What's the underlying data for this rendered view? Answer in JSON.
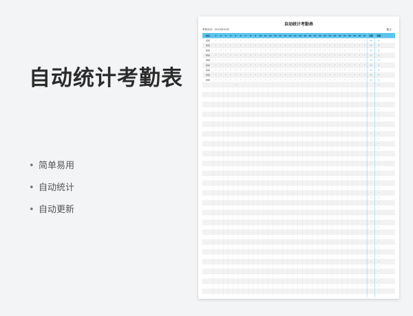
{
  "page": {
    "title": "自动统计考勤表"
  },
  "features": [
    "简单易用",
    "自动统计",
    "自动更新"
  ],
  "sheet": {
    "title": "自动统计考勤表",
    "month_label": "考勤月份：XXXX年XX月",
    "note": "备注：",
    "headers": {
      "name": "姓名",
      "days": [
        "1",
        "2",
        "3",
        "4",
        "5",
        "6",
        "7",
        "8",
        "9",
        "10",
        "11",
        "12",
        "13",
        "14",
        "15",
        "16",
        "17",
        "18",
        "19",
        "20",
        "21",
        "22",
        "23",
        "24",
        "25",
        "26",
        "27",
        "28",
        "29",
        "30",
        "31"
      ],
      "attend": "出勤",
      "absent": "缺勤"
    },
    "rows": [
      {
        "name": "某某",
        "marks": "√√√√√√√√√√√√√√√√√√√√√√√√√√√√√√√",
        "attend": "22",
        "absent": "8"
      },
      {
        "name": "某某",
        "marks": "√√√√√√√√√√√√√√√√√√√√√√√√√√√√√√√",
        "attend": "22",
        "absent": "8"
      },
      {
        "name": "某某",
        "marks": "√√√√√√√√√√√√√√√√√√√√√√√√√√√√√√√",
        "attend": "22",
        "absent": "8"
      },
      {
        "name": "某某",
        "marks": "√√√√√√√√√√√√√√√√√√√√√√√√√√√√√√√",
        "attend": "22",
        "absent": "8"
      },
      {
        "name": "某某",
        "marks": "√√√√√√√√√√√√√√√√√√√√√√√√√√√√√√√",
        "attend": "22",
        "absent": "8"
      },
      {
        "name": "某某",
        "marks": "√√√√√√√√√√√√√√√√√√√√√√√√√√√√√√√",
        "attend": "22",
        "absent": "8"
      },
      {
        "name": "某某",
        "marks": "√√√√√√√√√√√√√√√√√√√√√√√√√√√√√√√",
        "attend": "22",
        "absent": "8"
      },
      {
        "name": "某某",
        "marks": "√√√√√√√√√√√√√√√√√√√√√√√√√√√√√√√",
        "attend": "22",
        "absent": "8"
      },
      {
        "name": "某某",
        "marks": "√√√√√√√√√√√√√√√√√√√√√√√√√√√√√√√",
        "attend": "22",
        "absent": "8"
      },
      {
        "name": "",
        "marks": "√",
        "attend": "",
        "absent": "1"
      }
    ],
    "empty_attend": "0",
    "empty_absent": "0",
    "colors": {
      "header": "#5bc4ee",
      "header_text": "#1f3b57",
      "stripe": "#f2f2f2",
      "grid": "#e3e3e3",
      "accent": "#8fd0ee",
      "mark": "#7a7a7a",
      "count": "#4aa6d8"
    }
  }
}
